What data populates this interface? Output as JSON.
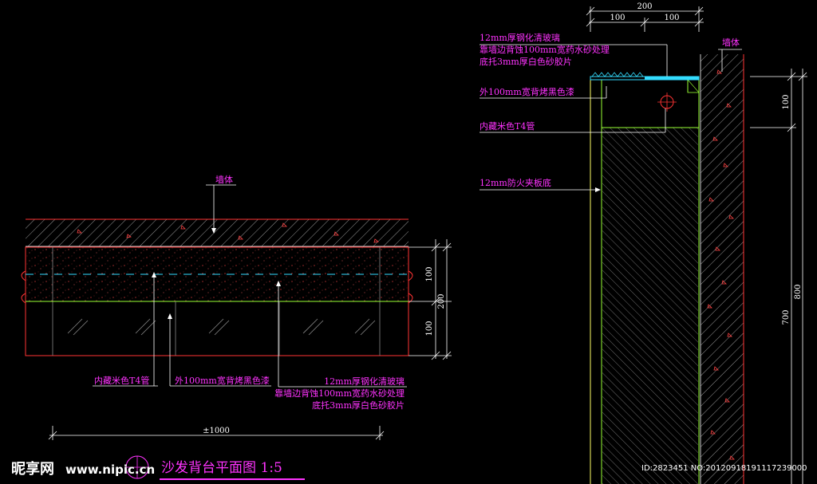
{
  "colors": {
    "background": "#000000",
    "annotation": "#ff33ff",
    "dimension": "#ffffff",
    "hatch": "#cccccc",
    "cyan": "#33ddff",
    "red": "#ff3333",
    "green": "#99ff33",
    "yellow": "#ffff66",
    "leader": "#ffffff"
  },
  "plan": {
    "wall_label": "墙体",
    "dim_100_a": "100",
    "dim_100_b": "100",
    "dim_200": "200",
    "label_t4": "内藏米色T4管",
    "label_paint": "外100mm宽背烤黑色漆",
    "label_glass_1": "12mm厚钢化清玻璃",
    "label_glass_2": "靠墙边背蚀100mm宽药水砂处理",
    "label_glass_3": "底托3mm厚白色砂胶片",
    "dim_width": "±1000",
    "title": "沙发背台平面图 1:5"
  },
  "section": {
    "dim_top_200": "200",
    "dim_top_100_a": "100",
    "dim_top_100_b": "100",
    "wall_label": "墙体",
    "label_glass_1": "12mm厚钢化清玻璃",
    "label_glass_2": "靠墙边背蚀100mm宽药水砂处理",
    "label_glass_3": "底托3mm厚白色砂胶片",
    "label_paint": "外100mm宽背烤黑色漆",
    "label_t4": "内藏米色T4管",
    "label_board": "12mm防火夹板底",
    "dim_100": "100",
    "dim_700": "700",
    "dim_800": "800"
  },
  "watermark": {
    "logo_text": "昵享网",
    "site": "www.nipic.cn",
    "id_text": "ID:2823451 NO:20120918191117239000"
  }
}
